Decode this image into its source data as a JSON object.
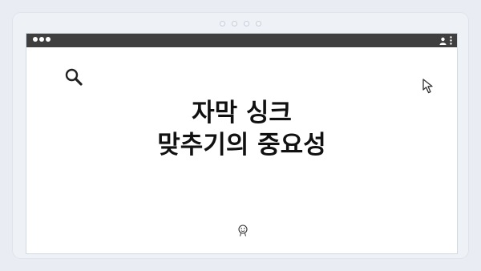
{
  "headline": {
    "line1": "자막 싱크",
    "line2": "맞추기의 중요성"
  },
  "icons": {
    "search": "search-icon",
    "cursor": "cursor-arrow-icon",
    "face": "smiley-face-icon",
    "user": "user-icon",
    "menu": "kebab-menu-icon"
  },
  "colors": {
    "titlebar": "#3f3f3f",
    "background": "#e9edf3",
    "content": "#ffffff",
    "text": "#111111"
  }
}
